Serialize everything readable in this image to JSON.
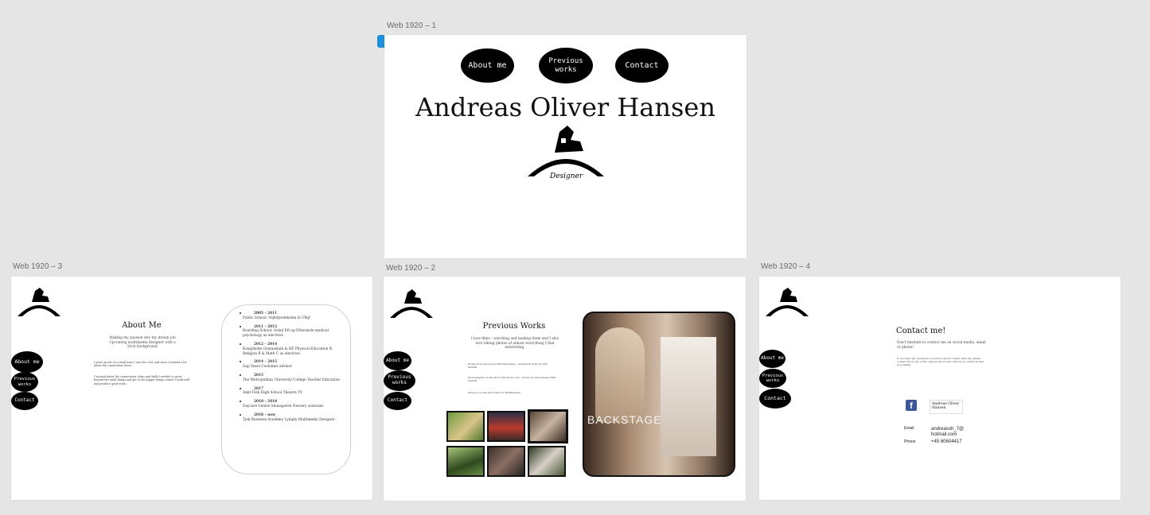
{
  "artboards": {
    "web1": {
      "label": "Web 1920 – 1"
    },
    "web2": {
      "label": "Web 1920 – 2"
    },
    "web3": {
      "label": "Web 1920 – 3"
    },
    "web4": {
      "label": "Web 1920 – 4"
    }
  },
  "nav": {
    "about": "About me",
    "previous": "Previous works",
    "contact": "Contact"
  },
  "home": {
    "name": "Andreas Oliver Hansen",
    "logo_caption": "Designer"
  },
  "about": {
    "title": "About Me",
    "tagline": "Making my passion into my dream job Upcoming multimedia designer with a trick background",
    "para1": "I grew up out of a small town I care for a lot, and since I learned a lot about the connections there...",
    "para2": "I learned about the connections, ideas and skills I needed to grow beyond the small things and get to the bigger things, where I work well and produce good work...",
    "timeline": [
      {
        "years": "2005 – 2011",
        "text": "Public School: Vejlefjordskolen in Ulkjr"
      },
      {
        "years": "2011 – 2012",
        "text": "Boarding School: Grind Eft og Efterskole medical psychology as electives"
      },
      {
        "years": "2012 – 2014",
        "text": "Kongsholm Gymnasium & HF Physical Education B, Religion B & Math C as electives"
      },
      {
        "years": "2014 – 2015",
        "text": "Gap Years Customer advisor"
      },
      {
        "years": "2015",
        "text": "The Metropolitan University College Teacher Education"
      },
      {
        "years": "2017",
        "text": "Ankr Folk High School Theatre TV"
      },
      {
        "years": "2018 – 2018",
        "text": "Daycare Centre Skuesporen Nursery assistant"
      },
      {
        "years": "2018 – now",
        "text": "Tjek Business Academy Lyngby Multimedia Designer"
      }
    ]
  },
  "works": {
    "title": "Previous Works",
    "intro": "I love films - watching and making them and I also love taking photos of almost everything I find interesting.",
    "notes": [
      "Producer in the school film Backstage · premiered at Roots film festival",
      "Photographer in the short film Rock I am · shown around Odense Film festival",
      "Director on the short film for Multimedier"
    ],
    "poster_text": "BACKSTAGE"
  },
  "contact": {
    "title": "Contact me!",
    "subtitle": "Don't hesitate to contact me on social media, email or phone!",
    "body": "If you have any questions or want to get in contact with me, please contact me in any of the options below and I will be in contact as fast as possible.",
    "facebook_name": "Andreas Oliver Hansen",
    "email_label": "Email",
    "email_value": "andreasoh_7@ hotmail.com",
    "phone_label": "Phone",
    "phone_value": "+45 60604417"
  },
  "icons": {
    "logo": "house-arch-logo-icon",
    "facebook": "facebook-icon"
  },
  "colors": {
    "canvas": "#e5e5e5",
    "artboard": "#ffffff",
    "nav_blob": "#000000",
    "selection": "#1a8fe0"
  }
}
